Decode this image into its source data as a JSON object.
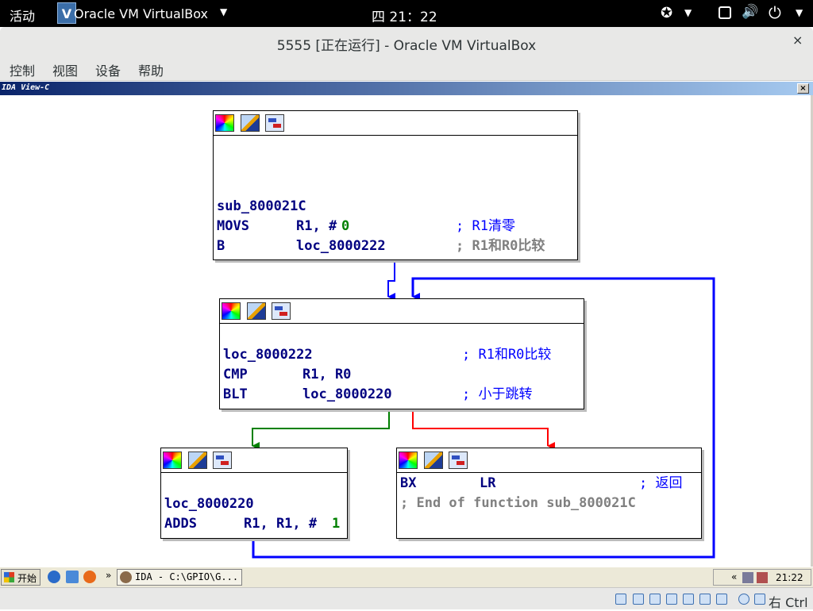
{
  "topbar": {
    "activities": "活动",
    "app_icon_letter": "V",
    "app_name": "Oracle VM VirtualBox",
    "clock": "四 21：22"
  },
  "window": {
    "title": "5555 [正在运行] - Oracle VM VirtualBox",
    "close": "×"
  },
  "menu": [
    "控制",
    "视图",
    "设备",
    "帮助"
  ],
  "ida": {
    "view_title": "IDA View-C",
    "close": "×",
    "nodes": {
      "n1": {
        "label": "sub_800021C",
        "l2_mn": "MOVS",
        "l2_op": "R1, #",
        "l2_num": "0",
        "l2_cmt": "; R1清零",
        "l3_mn": "B",
        "l3_op": "loc_8000222",
        "l3_cmt": "; R1和R0比较"
      },
      "n2": {
        "label": "loc_8000222",
        "label_cmt": "; R1和R0比较",
        "l2_mn": "CMP",
        "l2_op": "R1, R0",
        "l3_mn": "BLT",
        "l3_op": "loc_8000220",
        "l3_cmt": "; 小于跳转"
      },
      "n3": {
        "label": "loc_8000220",
        "l2_mn": "ADDS",
        "l2_op": "R1, R1, #",
        "l2_num": "1"
      },
      "n4": {
        "l1_mn": "BX",
        "l1_op": "LR",
        "l1_cmt": "; 返回",
        "l2_text": "; End of function sub_800021C"
      }
    }
  },
  "taskbar": {
    "start": "开始",
    "more": "»",
    "task_label": "IDA - C:\\GPIO\\G...",
    "tray_more": "«",
    "time": "21:22"
  },
  "statusbar": {
    "host_key": "右 Ctrl"
  },
  "colors": {
    "edge_normal": "#0000ff",
    "edge_true": "#008000",
    "edge_false": "#ff0000"
  }
}
